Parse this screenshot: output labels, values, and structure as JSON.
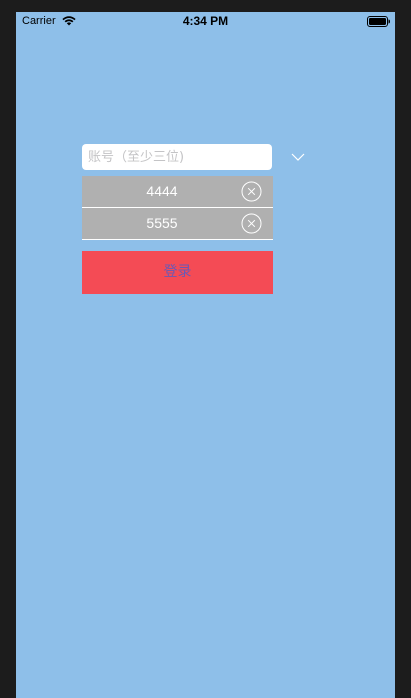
{
  "status_bar": {
    "carrier": "Carrier",
    "time": "4:34 PM",
    "wifi_icon": "wifi-icon",
    "battery_icon": "battery-icon"
  },
  "login_form": {
    "account_placeholder": "账号（至少三位)",
    "account_value": "",
    "dropdown_icon": "chevron-down-icon",
    "history": [
      {
        "value": "4444",
        "delete_icon": "clear-circle-icon"
      },
      {
        "value": "5555",
        "delete_icon": "clear-circle-icon"
      }
    ],
    "login_label": "登录"
  },
  "colors": {
    "background": "#8ebfe9",
    "history_item": "#b0b0b0",
    "login_button": "#f44b55",
    "login_text": "#6a59b5"
  }
}
